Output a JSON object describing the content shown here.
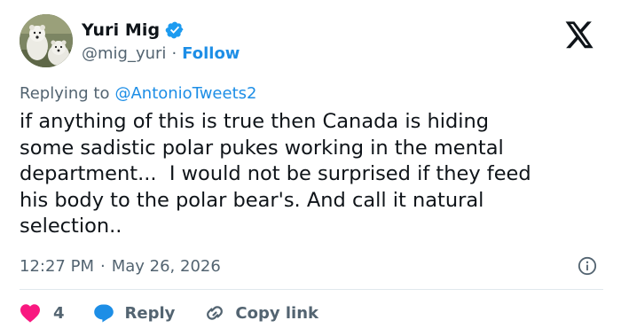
{
  "author": {
    "display_name": "Yuri Mig",
    "handle": "@mig_yuri",
    "separator": "·",
    "follow_label": "Follow",
    "avatar_icon": "avatar-polar-bears",
    "verified_icon": "verified-badge-icon"
  },
  "reply_context": {
    "prefix": "Replying to",
    "target": "@AntonioTweets2"
  },
  "tweet": {
    "text": "if anything of this is true then Canada is hiding\nsome sadistic polar pukes working in the mental\ndepartment...  I would not be surprised if they feed\nhis body to the polar bear's. And call it natural\nselection.."
  },
  "meta": {
    "time": "12:27 PM",
    "separator": "·",
    "date": "May 26, 2026"
  },
  "actions": {
    "like_count": "4",
    "reply_label": "Reply",
    "copy_label": "Copy link"
  },
  "colors": {
    "accent": "#1d8ee6",
    "like": "#f91880",
    "secondary_text": "#536471",
    "primary_text": "#0f1419",
    "divider": "#e1e8ed"
  }
}
